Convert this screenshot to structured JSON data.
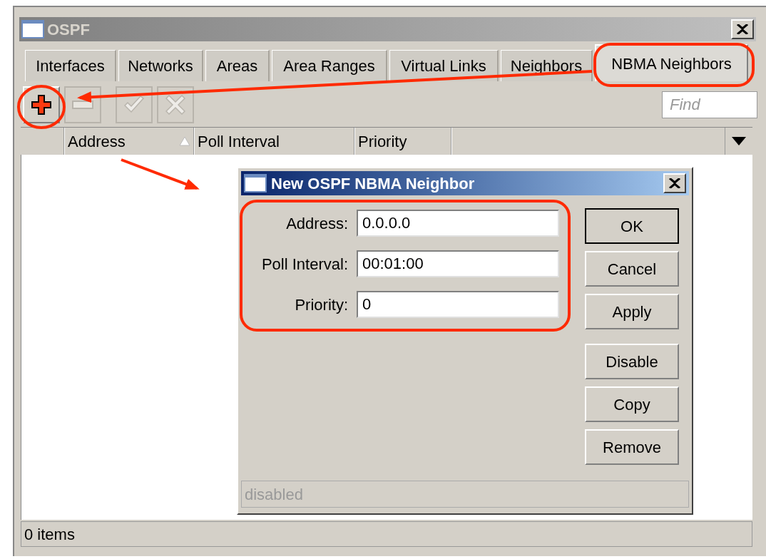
{
  "window": {
    "title": "OSPF"
  },
  "tabs": [
    {
      "label": "Interfaces",
      "selected": false
    },
    {
      "label": "Networks",
      "selected": false
    },
    {
      "label": "Areas",
      "selected": false
    },
    {
      "label": "Area Ranges",
      "selected": false
    },
    {
      "label": "Virtual Links",
      "selected": false
    },
    {
      "label": "Neighbors",
      "selected": false
    },
    {
      "label": "NBMA Neighbors",
      "selected": true
    }
  ],
  "toolbar": [
    {
      "kind": "add",
      "disabled": false
    },
    {
      "kind": "remove",
      "disabled": true
    },
    {
      "kind": "enable",
      "disabled": true
    },
    {
      "kind": "disable",
      "disabled": true
    }
  ],
  "find": {
    "placeholder": "Find"
  },
  "table": {
    "columns": [
      {
        "label": "Address",
        "sorted": true
      },
      {
        "label": "Poll Interval",
        "sorted": false
      },
      {
        "label": "Priority",
        "sorted": false
      }
    ]
  },
  "status_bar": "0 items",
  "dialog": {
    "title": "New OSPF NBMA Neighbor",
    "fields": [
      {
        "label": "Address:",
        "value": "0.0.0.0"
      },
      {
        "label": "Poll Interval:",
        "value": "00:01:00"
      },
      {
        "label": "Priority:",
        "value": "0"
      }
    ],
    "buttons": [
      {
        "label": "OK",
        "default": true
      },
      {
        "label": "Cancel",
        "default": false
      },
      {
        "label": "Apply",
        "default": false
      },
      {
        "label": "Disable",
        "default": false
      },
      {
        "label": "Copy",
        "default": false
      },
      {
        "label": "Remove",
        "default": false
      }
    ],
    "status": "disabled"
  }
}
